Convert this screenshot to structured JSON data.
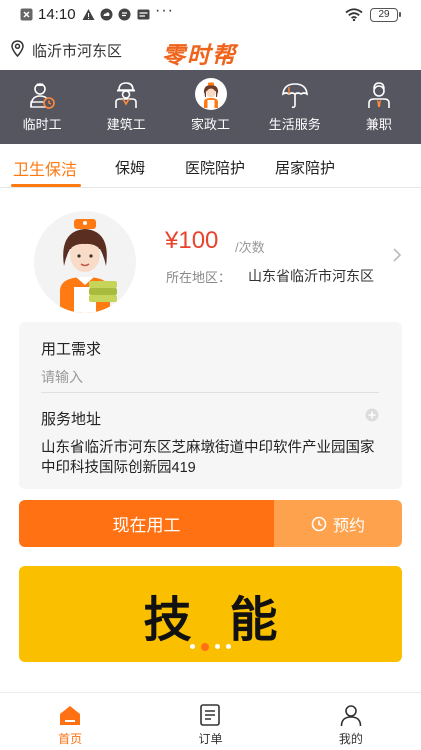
{
  "status_bar": {
    "time": "14:10",
    "dots": "···",
    "battery": "29",
    "icons": [
      "close-box-icon",
      "warning-icon",
      "cloud-icon",
      "message-icon",
      "card-icon",
      "wifi-icon",
      "battery-icon"
    ]
  },
  "header": {
    "location": "临沂市河东区",
    "logo": "零时帮",
    "icons": [
      "location-pin-icon"
    ]
  },
  "categories": [
    {
      "label": "临时工",
      "icon": "worker-clock-icon"
    },
    {
      "label": "建筑工",
      "icon": "construction-worker-icon"
    },
    {
      "label": "家政工",
      "icon": "housekeeper-icon",
      "active": true
    },
    {
      "label": "生活服务",
      "icon": "umbrella-icon"
    },
    {
      "label": "兼职",
      "icon": "suit-person-icon"
    }
  ],
  "service_tabs": [
    {
      "label": "卫生保洁",
      "active": true
    },
    {
      "label": "保姆"
    },
    {
      "label": "医院陪护"
    },
    {
      "label": "居家陪护"
    }
  ],
  "service": {
    "price": "¥100",
    "unit": "/次数",
    "region_label": "所在地区：",
    "region_value": "山东省临沂市河东区"
  },
  "form": {
    "demand_label": "用工需求",
    "demand_placeholder": "请输入",
    "address_label": "服务地址",
    "address_value": "山东省临沂市河东区芝麻墩街道中印软件产业园国家中印科技国际创新园419"
  },
  "actions": {
    "now_label": "现在用工",
    "book_label": "预约"
  },
  "banner": {
    "text": "技能",
    "slides": 4,
    "active_slide": 1
  },
  "bottom_nav": [
    {
      "label": "首页",
      "icon": "home-icon",
      "active": true
    },
    {
      "label": "订单",
      "icon": "order-icon"
    },
    {
      "label": "我的",
      "icon": "profile-icon"
    }
  ],
  "colors": {
    "accent": "#ff7112",
    "accent_light": "#ffa24d",
    "nav_bg": "#55565f",
    "price": "#e8432b",
    "banner_bg": "#fac000"
  }
}
